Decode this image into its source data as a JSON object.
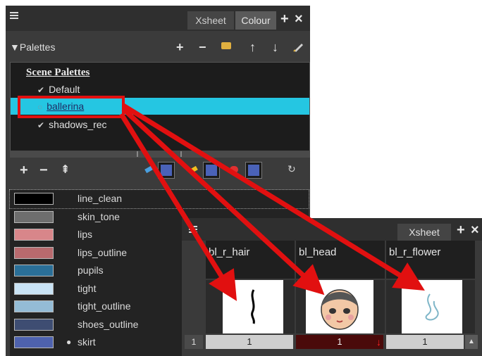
{
  "colour_panel": {
    "tabs": {
      "xsheet": "Xsheet",
      "colour": "Colour"
    },
    "header_buttons": {
      "add": "+",
      "close": "×"
    },
    "palettes_label": "Palettes",
    "palette_toolbar": {
      "add": "+",
      "remove": "−",
      "move_up": "↑",
      "move_down": "↓"
    },
    "palette_list": {
      "header": "Scene Palettes",
      "items": [
        "Default",
        "ballerina",
        "shadows_rec"
      ],
      "selected": "ballerina"
    },
    "swatch_toolbar": {
      "add": "+",
      "remove": "−"
    },
    "colours": [
      {
        "name": "line_clean",
        "color": "#000000",
        "selected": true
      },
      {
        "name": "skin_tone",
        "color": "#6e6e6e"
      },
      {
        "name": "lips",
        "color": "#d8868a"
      },
      {
        "name": "lips_outline",
        "color": "#b86a6e"
      },
      {
        "name": "pupils",
        "color": "#2a6f98"
      },
      {
        "name": "tight",
        "color": "#c9e3f5"
      },
      {
        "name": "tight_outline",
        "color": "#94bcd6"
      },
      {
        "name": "shoes_outline",
        "color": "#3e4d72"
      },
      {
        "name": "skirt",
        "color": "#4e62ae",
        "marker": "●"
      }
    ]
  },
  "xsheet_panel": {
    "tab": "Xsheet",
    "header_buttons": {
      "add": "+",
      "close": "×"
    },
    "columns": [
      {
        "name": "bl_r_hair",
        "frame": "1"
      },
      {
        "name": "bl_head",
        "frame": "1"
      },
      {
        "name": "bl_r_flower",
        "frame": "1"
      }
    ],
    "row_number": "1"
  },
  "colors": {
    "highlight": "#e11010",
    "selection": "#25c6e2"
  }
}
